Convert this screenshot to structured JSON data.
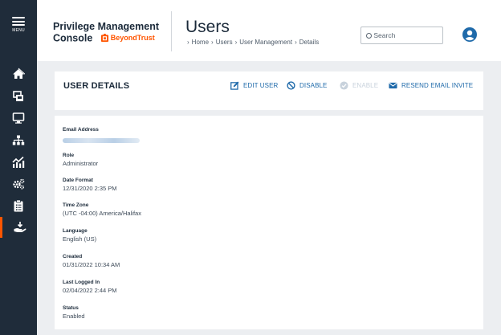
{
  "nav": {
    "menu_label": "MENU",
    "items": [
      {
        "icon": "home-icon"
      },
      {
        "icon": "computer-group-icon"
      },
      {
        "icon": "monitor-icon"
      },
      {
        "icon": "hierarchy-icon"
      },
      {
        "icon": "analytics-icon"
      },
      {
        "icon": "gears-icon"
      },
      {
        "icon": "clipboard-icon"
      },
      {
        "icon": "hand-download-icon"
      }
    ]
  },
  "header": {
    "brand_line1": "Privilege Management",
    "brand_line2": "Console",
    "logo_text": "BeyondTrust",
    "page_title": "Users",
    "breadcrumb": [
      "Home",
      "Users",
      "User Management",
      "Details"
    ],
    "search_placeholder": "Search"
  },
  "card": {
    "title": "USER DETAILS",
    "actions": {
      "edit": "EDIT USER",
      "disable": "DISABLE",
      "enable": "ENABLE",
      "resend": "RESEND EMAIL INVITE"
    }
  },
  "details": {
    "email_label": "Email Address",
    "role_label": "Role",
    "role_value": "Administrator",
    "date_format_label": "Date Format",
    "date_format_value": "12/31/2020 2:35 PM",
    "time_zone_label": "Time Zone",
    "time_zone_value": "(UTC -04:00) America/Halifax",
    "language_label": "Language",
    "language_value": "English (US)",
    "created_label": "Created",
    "created_value": "01/31/2022 10:34 AM",
    "last_logged_label": "Last Logged In",
    "last_logged_value": "02/04/2022 2:44 PM",
    "status_label": "Status",
    "status_value": "Enabled"
  },
  "colors": {
    "rail": "#1f2c3a",
    "accent": "#ff5500",
    "link": "#1f6aaa",
    "background": "#eceef1"
  }
}
